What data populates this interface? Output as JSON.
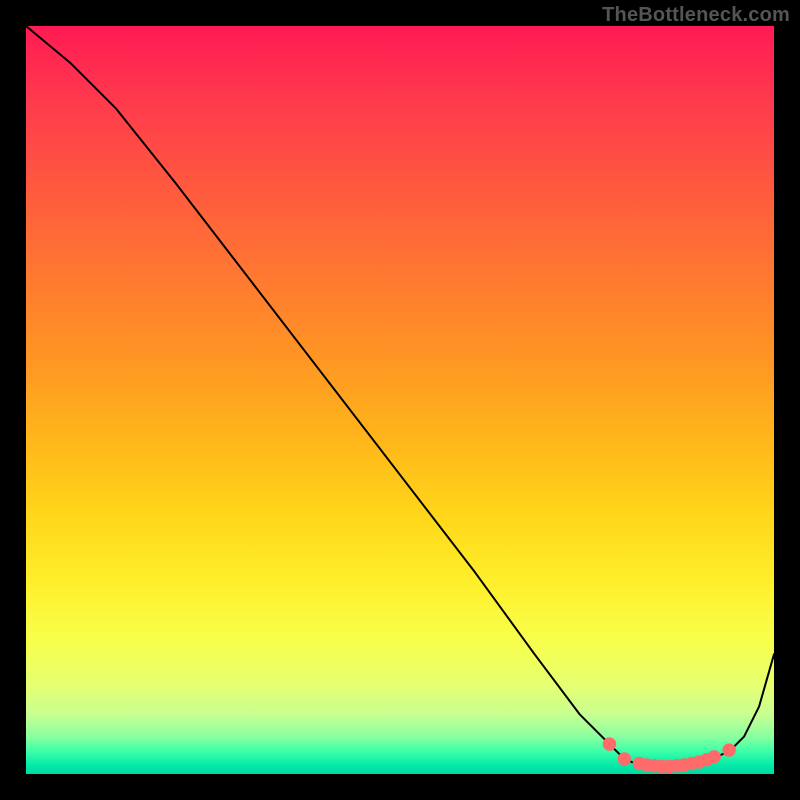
{
  "watermark": "TheBottleneck.com",
  "chart_data": {
    "type": "line",
    "title": "",
    "xlabel": "",
    "ylabel": "",
    "xlim": [
      0,
      100
    ],
    "ylim": [
      0,
      100
    ],
    "series": [
      {
        "name": "curve",
        "x": [
          0,
          6,
          12,
          20,
          30,
          40,
          50,
          60,
          68,
          74,
          78,
          80,
          82,
          84,
          86,
          88,
          90,
          92,
          94,
          96,
          98,
          100
        ],
        "y": [
          100,
          95,
          89,
          79,
          66,
          53,
          40,
          27,
          16,
          8,
          4,
          2,
          1.2,
          1,
          1,
          1.2,
          1.6,
          2.2,
          3,
          5,
          9,
          16
        ]
      }
    ],
    "markers": {
      "name": "optimal-range",
      "x": [
        78,
        80,
        82,
        83,
        84,
        85,
        86,
        87,
        88,
        89,
        90,
        91,
        92,
        94
      ],
      "y": [
        4,
        2,
        1.4,
        1.2,
        1.1,
        1.0,
        1.0,
        1.1,
        1.2,
        1.4,
        1.6,
        1.9,
        2.3,
        3.2
      ]
    },
    "background_gradient": {
      "top": "#ff1a53",
      "mid": "#ffee2a",
      "bottom": "#00d8a0"
    }
  }
}
